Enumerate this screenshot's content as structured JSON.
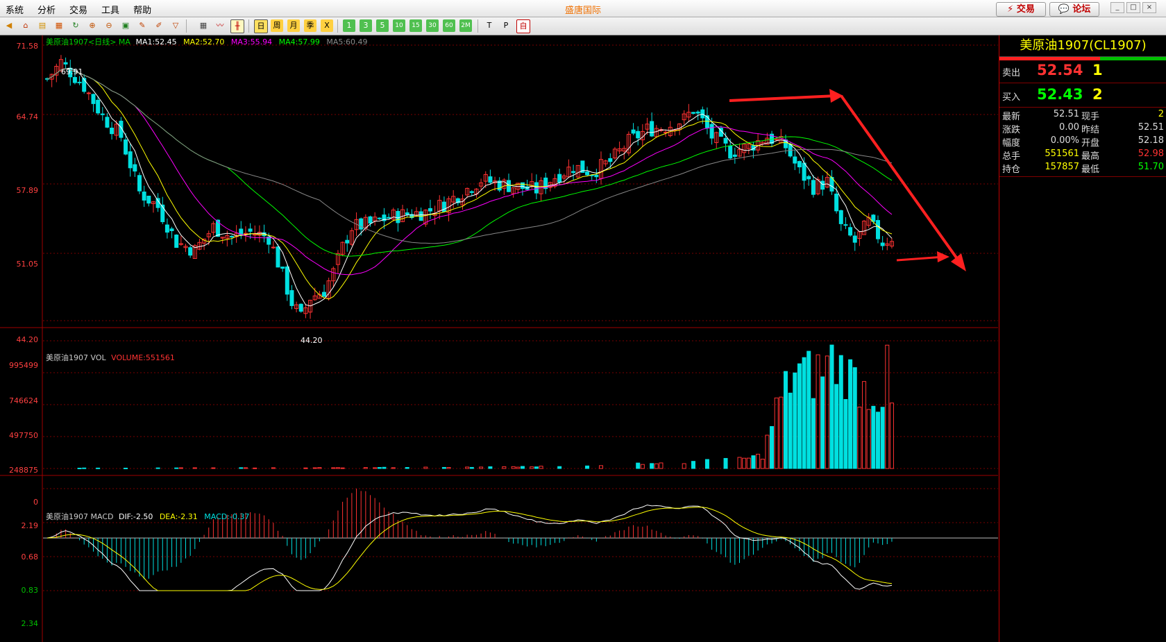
{
  "window": {
    "title": "盛唐国际",
    "menu": [
      "系统",
      "分析",
      "交易",
      "工具",
      "帮助"
    ],
    "trade_button": "⚡ 交易",
    "forum_button": "💬 论坛"
  },
  "toolbar": {
    "icons": [
      "back-icon",
      "home-icon",
      "book-icon",
      "film-icon",
      "refresh-icon",
      "zoom-in-icon",
      "zoom-out-icon",
      "window-icon",
      "pen-icon",
      "paint-icon",
      "funnel-icon",
      "grid-icon",
      "line-chart-icon",
      "kline-icon"
    ],
    "periods": [
      "日",
      "周",
      "月",
      "季",
      "X"
    ],
    "minutes": [
      "1",
      "3",
      "5",
      "10",
      "15",
      "30",
      "60",
      "2M"
    ],
    "tools": [
      "T",
      "P",
      "自"
    ]
  },
  "colors": {
    "up": "#ff3232",
    "down": "#00e0e0",
    "ma1": "#ffffff",
    "ma2": "#ffff00",
    "ma3": "#ff00ff",
    "ma4": "#00ff00",
    "ma5": "#888888",
    "grid": "#7a0000"
  },
  "main_legend": {
    "symbol": "美原油1907<日线> MA",
    "ma1": "MA1:52.45",
    "ma2": "MA2:52.70",
    "ma3": "MA3:55.94",
    "ma4": "MA4:57.99",
    "ma5": "MA5:60.49"
  },
  "vol_legend": {
    "symbol": "美原油1907 VOL",
    "value": "VOLUME:551561"
  },
  "macd_legend": {
    "symbol": "美原油1907 MACD",
    "dif": "DIF:-2.50",
    "dea": "DEA:-2.31",
    "macd": "MACD:-0.37"
  },
  "axes": {
    "price_ticks": [
      "71.58",
      "64.74",
      "57.89",
      "51.05",
      "44.20"
    ],
    "vol_ticks": [
      "995499",
      "746624",
      "497750",
      "248875",
      "0"
    ],
    "macd_ticks": [
      "2.19",
      "0.68",
      "0.83",
      "2.34"
    ],
    "high_label": "69.91",
    "low_label": "44.20"
  },
  "chart_data": {
    "type": "candlestick",
    "price_range": [
      44.2,
      71.58
    ],
    "volume_range": [
      0,
      995499
    ],
    "macd_range": [
      -2.34,
      2.19
    ],
    "price_anchors": [
      [
        0,
        68.2
      ],
      [
        3,
        69.9
      ],
      [
        8,
        67.5
      ],
      [
        12,
        64.5
      ],
      [
        16,
        62.5
      ],
      [
        20,
        57.0
      ],
      [
        24,
        55.5
      ],
      [
        28,
        52.0
      ],
      [
        32,
        51.2
      ],
      [
        36,
        53.5
      ],
      [
        40,
        52.5
      ],
      [
        44,
        53.0
      ],
      [
        48,
        52.5
      ],
      [
        50,
        50.0
      ],
      [
        53,
        46.0
      ],
      [
        55,
        44.5
      ],
      [
        57,
        46.5
      ],
      [
        60,
        47.2
      ],
      [
        62,
        49.0
      ],
      [
        64,
        51.5
      ],
      [
        66,
        53.5
      ],
      [
        70,
        53.8
      ],
      [
        74,
        54.5
      ],
      [
        78,
        54.8
      ],
      [
        82,
        55.0
      ],
      [
        86,
        55.8
      ],
      [
        90,
        57.0
      ],
      [
        94,
        58.2
      ],
      [
        98,
        57.8
      ],
      [
        102,
        57.5
      ],
      [
        106,
        57.2
      ],
      [
        110,
        58.5
      ],
      [
        114,
        59.5
      ],
      [
        118,
        59.0
      ],
      [
        122,
        60.0
      ],
      [
        126,
        62.0
      ],
      [
        130,
        63.2
      ],
      [
        134,
        63.5
      ],
      [
        138,
        64.2
      ],
      [
        140,
        65.2
      ],
      [
        142,
        64.0
      ],
      [
        144,
        62.5
      ],
      [
        148,
        61.0
      ],
      [
        152,
        61.5
      ],
      [
        156,
        62.5
      ],
      [
        160,
        61.5
      ],
      [
        163,
        59.0
      ],
      [
        166,
        57.5
      ],
      [
        169,
        58.0
      ],
      [
        172,
        53.5
      ],
      [
        175,
        52.0
      ],
      [
        178,
        54.0
      ],
      [
        181,
        52.0
      ],
      [
        183,
        52.5
      ]
    ],
    "volume_anchors": [
      [
        0,
        4000
      ],
      [
        40,
        6000
      ],
      [
        70,
        8000
      ],
      [
        100,
        15000
      ],
      [
        110,
        20000
      ],
      [
        120,
        30000
      ],
      [
        130,
        45000
      ],
      [
        140,
        60000
      ],
      [
        150,
        80000
      ],
      [
        155,
        120000
      ],
      [
        158,
        550000
      ],
      [
        162,
        900000
      ],
      [
        166,
        850000
      ],
      [
        170,
        990000
      ],
      [
        174,
        850000
      ],
      [
        178,
        700000
      ],
      [
        181,
        650000
      ],
      [
        182,
        880000
      ],
      [
        183,
        551561
      ]
    ],
    "ma_legend": {
      "MA1": 52.45,
      "MA2": 52.7,
      "MA3": 55.94,
      "MA4": 57.99,
      "MA5": 60.49
    },
    "last": {
      "DIF": -2.5,
      "DEA": -2.31,
      "MACD": -0.37
    }
  },
  "quote": {
    "title": "美原油1907(CL1907)",
    "sell_label": "卖出",
    "sell_price": "52.54",
    "sell_qty": "1",
    "buy_label": "买入",
    "buy_price": "52.43",
    "buy_qty": "2",
    "rows": [
      {
        "l1": "最新",
        "v1": "52.51",
        "l2": "现手",
        "v2": "2"
      },
      {
        "l1": "涨跌",
        "v1": "0.00",
        "l2": "昨结",
        "v2": "52.51"
      },
      {
        "l1": "幅度",
        "v1": "0.00%",
        "l2": "开盘",
        "v2": "52.18"
      },
      {
        "l1": "总手",
        "v1": "551561",
        "l2": "最高",
        "v2": "52.98"
      },
      {
        "l1": "持仓",
        "v1": "157857",
        "l2": "最低",
        "v2": "51.70"
      }
    ]
  }
}
